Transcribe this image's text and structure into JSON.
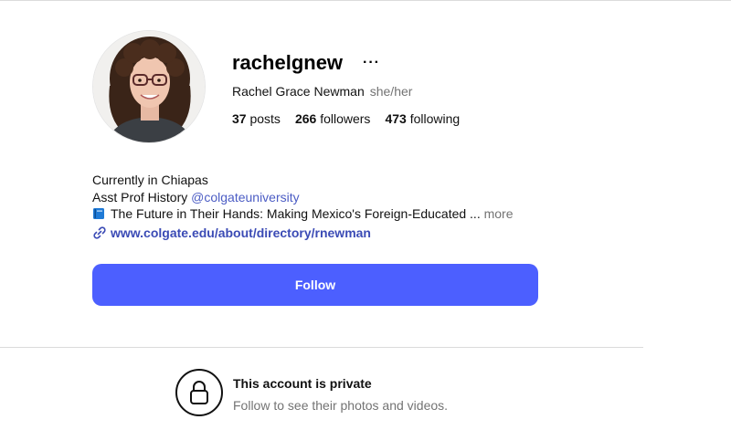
{
  "profile": {
    "username": "rachelgnew",
    "options_label": "···",
    "full_name": "Rachel Grace Newman",
    "pronouns": "she/her",
    "stats": {
      "posts_count": "37",
      "posts_label": "posts",
      "followers_count": "266",
      "followers_label": "followers",
      "following_count": "473",
      "following_label": "following"
    }
  },
  "bio": {
    "line1": "Currently in Chiapas",
    "line2_prefix": "Asst Prof History",
    "line2_mention": "@colgateuniversity",
    "line3_text": "The Future in Their Hands: Making Mexico's Foreign-Educated ...",
    "line3_more": "more",
    "line3_icon": "blue-book-icon",
    "link_icon": "link-icon",
    "link": "www.colgate.edu/about/directory/rnewman"
  },
  "actions": {
    "follow_label": "Follow"
  },
  "private_notice": {
    "icon": "lock-icon",
    "title": "This account is private",
    "subtitle": "Follow to see their photos and videos."
  },
  "colors": {
    "accent": "#4c5fff",
    "link": "#3b4bb5",
    "mention": "#4b5cc4",
    "secondary_text": "#737373"
  }
}
